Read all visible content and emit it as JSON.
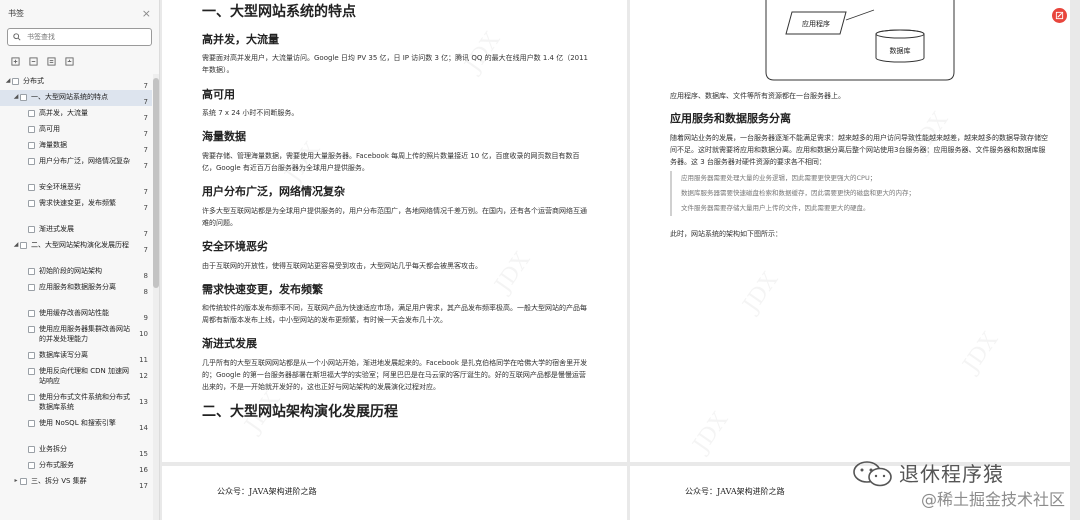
{
  "sidebar": {
    "title": "书签",
    "close": "×",
    "search_placeholder": "书签查找",
    "items": [
      {
        "label": "分布式",
        "page": "7"
      },
      {
        "label": "一、大型网站系统的特点",
        "page": "7"
      },
      {
        "label": "高并发，大流量",
        "page": "7"
      },
      {
        "label": "高可用",
        "page": "7"
      },
      {
        "label": "海量数据",
        "page": "7"
      },
      {
        "label": "用户分布广泛，网络情况复杂",
        "page": "7"
      },
      {
        "label": "安全环境恶劣",
        "page": "7"
      },
      {
        "label": "需求快速变更，发布频繁",
        "page": "7"
      },
      {
        "label": "渐进式发展",
        "page": "7"
      },
      {
        "label": "二、大型网站架构演化发展历程",
        "page": "7"
      },
      {
        "label": "初始阶段的网站架构",
        "page": "8"
      },
      {
        "label": "应用服务和数据服务分离",
        "page": "8"
      },
      {
        "label": "使用缓存改善网站性能",
        "page": "9"
      },
      {
        "label": "使用应用服务器集群改善网站的并发处理能力",
        "page": "10"
      },
      {
        "label": "数据库读写分离",
        "page": "11"
      },
      {
        "label": "使用反向代理和 CDN 加速网站响应",
        "page": "12"
      },
      {
        "label": "使用分布式文件系统和分布式数据库系统",
        "page": "13"
      },
      {
        "label": "使用 NoSQL 和搜索引擎",
        "page": "14"
      },
      {
        "label": "业务拆分",
        "page": "15"
      },
      {
        "label": "分布式服务",
        "page": "16"
      },
      {
        "label": "三、拆分 VS 集群",
        "page": "17"
      }
    ]
  },
  "left_page": {
    "title": "一、大型网站系统的特点",
    "sections": [
      {
        "heading": "高并发，大流量",
        "text": "需要面对高并发用户，大流量访问。Google 日均 PV 35 亿，日 IP 访问数 3 亿；腾讯 QQ 的最大在线用户数 1.4 亿（2011年数据）。"
      },
      {
        "heading": "高可用",
        "text": "系统 7 x 24 小时不间断服务。"
      },
      {
        "heading": "海量数据",
        "text": "需要存储、管理海量数据，需要使用大量服务器。Facebook 每周上传的照片数量接近 10 亿，百度收录的网页数目有数百亿，Google 有近百万台服务器为全球用户提供服务。"
      },
      {
        "heading": "用户分布广泛，网络情况复杂",
        "text": "许多大型互联网站都是为全球用户提供服务的，用户分布范围广，各地网络情况千差万别。在国内，还有各个运营商网络互通难的问题。"
      },
      {
        "heading": "安全环境恶劣",
        "text": "由于互联网的开放性，使得互联网站更容易受到攻击，大型网站几乎每天都会被黑客攻击。"
      },
      {
        "heading": "需求快速变更，发布频繁",
        "text": "和传统软件的版本发布频率不同，互联网产品为快速适应市场，满足用户需求，其产品发布频率极高。一般大型网站的产品每周都有新版本发布上线，中小型网站的发布更频繁，有时候一天会发布几十次。"
      },
      {
        "heading": "渐进式发展",
        "text": "几乎所有的大型互联网网站都是从一个小网站开始，渐进地发展起来的。Facebook 是扎克伯格同学在哈佛大学的宿舍里开发的；Google 的第一台服务器部署在斯坦福大学的实验室；阿里巴巴是在马云家的客厅诞生的。好的互联网产品都是慢慢运营出来的，不是一开始就开发好的，这也正好与网站架构的发展演化过程对应。"
      }
    ],
    "title2": "二、大型网站架构演化发展历程",
    "footer": "公众号：JAVA架构进阶之路"
  },
  "right_page": {
    "diagram": {
      "app_label": "应用程序",
      "db_label": "数据库"
    },
    "caption": "应用程序、数据库、文件等所有资源都在一台服务器上。",
    "heading": "应用服务和数据服务分离",
    "para": "随着网站业务的发展，一台服务器逐渐不能满足需求：越来越多的用户访问导致性能越来越差，越来越多的数据导致存储空间不足。这时就需要将应用和数据分离。应用和数据分离后整个网站使用3台服务器：应用服务器、文件服务器和数据库服务器。这 3 台服务器对硬件资源的要求各不相同：",
    "quotes": [
      "应用服务器需要处理大量的业务逻辑，因此需要更快更强大的CPU；",
      "数据库服务器需要快速磁盘检索和数据缓存，因此需要更快的磁盘和更大的内存；",
      "文件服务器需要存储大量用户上传的文件，因此需要更大的硬盘。"
    ],
    "after": "此时，网站系统的架构如下图所示：",
    "footer": "公众号：JAVA架构进阶之路"
  },
  "watermark_text": "JDX",
  "brand": {
    "line1": "退休程序猿",
    "line2": "@稀土掘金技术社区"
  },
  "colors": {
    "accent": "#e8453c",
    "active_item": "#dde4ee"
  }
}
